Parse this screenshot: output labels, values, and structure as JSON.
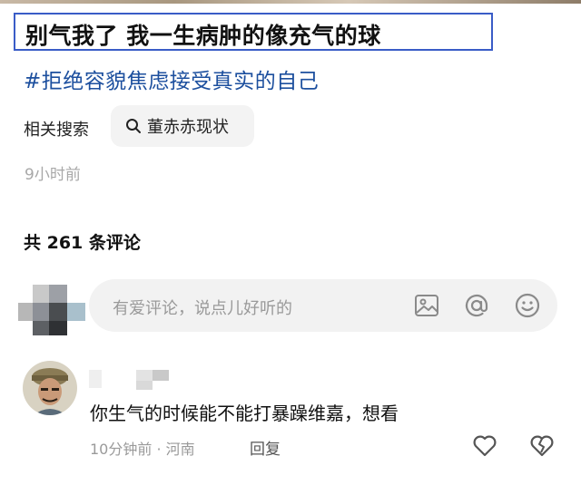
{
  "post": {
    "title": "别气我了 我一生病肿的像充气的球",
    "hashtag": "#拒绝容貌焦虑接受真实的自己",
    "time": "9小时前"
  },
  "related_search": {
    "label": "相关搜索",
    "chip_text": "董赤赤现状",
    "icon": "search-icon"
  },
  "comments": {
    "count_label": "共 261 条评论",
    "input_placeholder": "有爱评论，说点儿好听的",
    "input_icons": [
      "image-icon",
      "at-icon",
      "emoji-icon"
    ],
    "items": [
      {
        "text": "你生气的时候能不能打暴躁维嘉，想看",
        "meta": "10分钟前 · 河南",
        "reply_label": "回复",
        "actions": [
          "like-heart-icon",
          "dislike-broken-heart-icon"
        ]
      }
    ]
  },
  "colors": {
    "highlight_border": "#3a5cc7",
    "hashtag": "#1c4f9e",
    "muted": "#9a9a9a"
  }
}
